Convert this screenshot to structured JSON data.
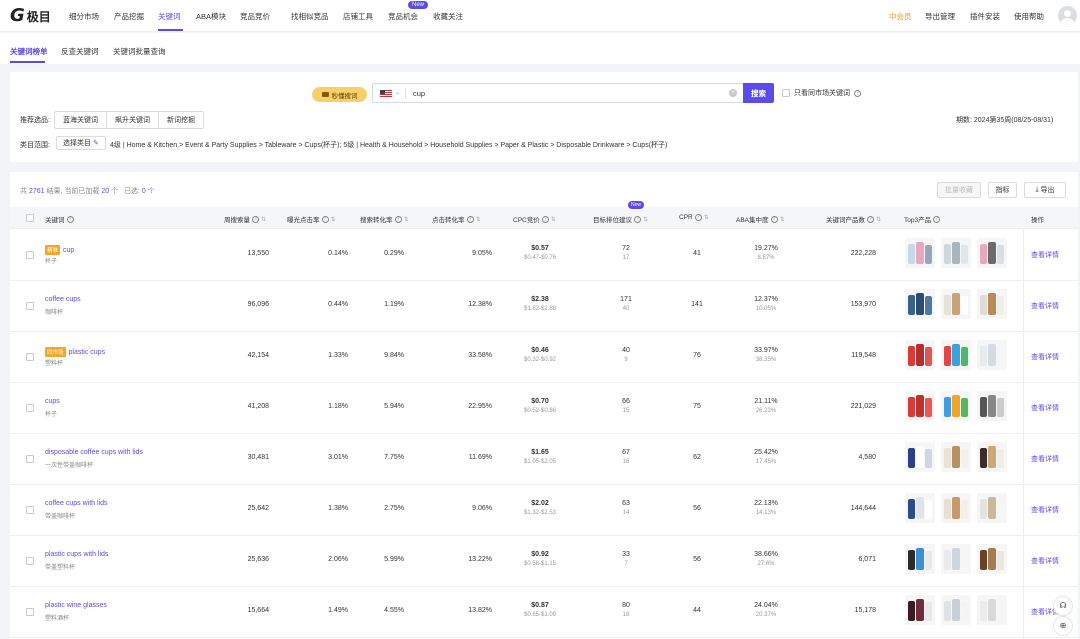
{
  "nav": {
    "logo_text": "极目",
    "items": [
      "细分市场",
      "产品挖掘",
      "关键词",
      "ABA模块",
      "竞品竞价",
      "找相似竞品",
      "店铺工具",
      "竞品机会",
      "收藏关注"
    ],
    "new_badge": "New",
    "right": [
      "中会员",
      "导出管理",
      "插件安装",
      "使用帮助"
    ]
  },
  "subtabs": [
    "关键词榜单",
    "反查关键词",
    "关键词批量查询"
  ],
  "search": {
    "image_search_label": "秒懂搜词",
    "value": "cup",
    "clear_glyph": "×",
    "button": "搜索",
    "same_market_label": "只看同市场关键词",
    "rec_label": "推荐选品:",
    "chips": [
      "蓝海关键词",
      "飙升关键词",
      "新词挖掘"
    ],
    "period": "期数: 2024第35周(08/25-08/31)",
    "cat_label": "类目范围:",
    "cat_button": "选择类目",
    "cat_path": "4级 | Home & Kitchen > Event & Party Supplies > Tableware > Cups(杯子); 5级 | Health & Household > Household Supplies > Paper & Plastic > Disposable Drinkware > Cups(杯子)"
  },
  "table": {
    "summary_prefix": "共",
    "total": "2761",
    "summary_mid": "结果, 当前已加载",
    "loaded": "20",
    "summary_unit": "个",
    "selected_label": "已选:",
    "selected": "0",
    "buttons": {
      "batch": "批量收藏",
      "metrics": "指标",
      "export": "导出"
    },
    "headers": [
      "关键词",
      "周搜索量",
      "曝光点击率",
      "搜索转化率",
      "点击转化率",
      "CPC竞价",
      "目标排位建议",
      "CPR",
      "ABA集中度",
      "关键词产品数",
      "Top3产品",
      "操作"
    ],
    "header_new": "New",
    "detail_label": "查看详情",
    "rows": [
      {
        "kw": "cup",
        "tag": "精准",
        "cn": "杯子",
        "search": "13,550",
        "ctr": "0.14%",
        "scr": "0.29%",
        "ccr": "9.05%",
        "cpc": "$0.57",
        "cpc_range": "$0.47-$0.76",
        "rank": "72",
        "rank_sub": "17",
        "cpr": "41",
        "aba": "19.27%",
        "aba_sub": "8.87%",
        "products": "222,228"
      },
      {
        "kw": "coffee cups",
        "tag": "",
        "cn": "咖啡杯",
        "search": "96,096",
        "ctr": "0.44%",
        "scr": "1.19%",
        "ccr": "12.38%",
        "cpc": "$2.38",
        "cpc_range": "$1.82-$2.88",
        "rank": "171",
        "rank_sub": "40",
        "cpr": "141",
        "aba": "12.37%",
        "aba_sub": "10.05%",
        "products": "153,970"
      },
      {
        "kw": "plastic cups",
        "tag": "同市场",
        "cn": "塑料杯",
        "search": "42,154",
        "ctr": "1.33%",
        "scr": "9.84%",
        "ccr": "33.58%",
        "cpc": "$0.46",
        "cpc_range": "$0.32-$0.92",
        "rank": "40",
        "rank_sub": "9",
        "cpr": "76",
        "aba": "33.97%",
        "aba_sub": "38.35%",
        "products": "119,548"
      },
      {
        "kw": "cups",
        "tag": "",
        "cn": "杯子",
        "search": "41,208",
        "ctr": "1.18%",
        "scr": "5.94%",
        "ccr": "22.95%",
        "cpc": "$0.70",
        "cpc_range": "$0.52-$0.86",
        "rank": "66",
        "rank_sub": "15",
        "cpr": "75",
        "aba": "21.11%",
        "aba_sub": "26.23%",
        "products": "221,029"
      },
      {
        "kw": "disposable coffee cups with lids",
        "tag": "",
        "cn": "一次性带盖咖啡杯",
        "search": "30,481",
        "ctr": "3.01%",
        "scr": "7.75%",
        "ccr": "11.69%",
        "cpc": "$1.65",
        "cpc_range": "$1.05-$2.05",
        "rank": "67",
        "rank_sub": "16",
        "cpr": "62",
        "aba": "25.42%",
        "aba_sub": "17.45%",
        "products": "4,580"
      },
      {
        "kw": "coffee cups with lids",
        "tag": "",
        "cn": "带盖咖啡杯",
        "search": "25,642",
        "ctr": "1.38%",
        "scr": "2.75%",
        "ccr": "9.06%",
        "cpc": "$2.02",
        "cpc_range": "$1.32-$2.53",
        "rank": "63",
        "rank_sub": "14",
        "cpr": "56",
        "aba": "22.13%",
        "aba_sub": "14.13%",
        "products": "144,644"
      },
      {
        "kw": "plastic cups with lids",
        "tag": "",
        "cn": "带盖塑料杯",
        "search": "25,636",
        "ctr": "2.06%",
        "scr": "5.99%",
        "ccr": "13.22%",
        "cpc": "$0.92",
        "cpc_range": "$0.58-$1.15",
        "rank": "33",
        "rank_sub": "7",
        "cpr": "56",
        "aba": "38.66%",
        "aba_sub": "27.6%",
        "products": "6,071"
      },
      {
        "kw": "plastic wine glasses",
        "tag": "",
        "cn": "塑料酒杯",
        "search": "15,664",
        "ctr": "1.49%",
        "scr": "4.55%",
        "ccr": "13.82%",
        "cpc": "$0.87",
        "cpc_range": "$0.65-$1.09",
        "rank": "80",
        "rank_sub": "18",
        "cpr": "44",
        "aba": "24.04%",
        "aba_sub": "20.37%",
        "products": "15,178"
      }
    ]
  },
  "colors": {
    "accent": "#5b4be8",
    "vip": "#f29a1f",
    "tag": "#f7a52a"
  }
}
